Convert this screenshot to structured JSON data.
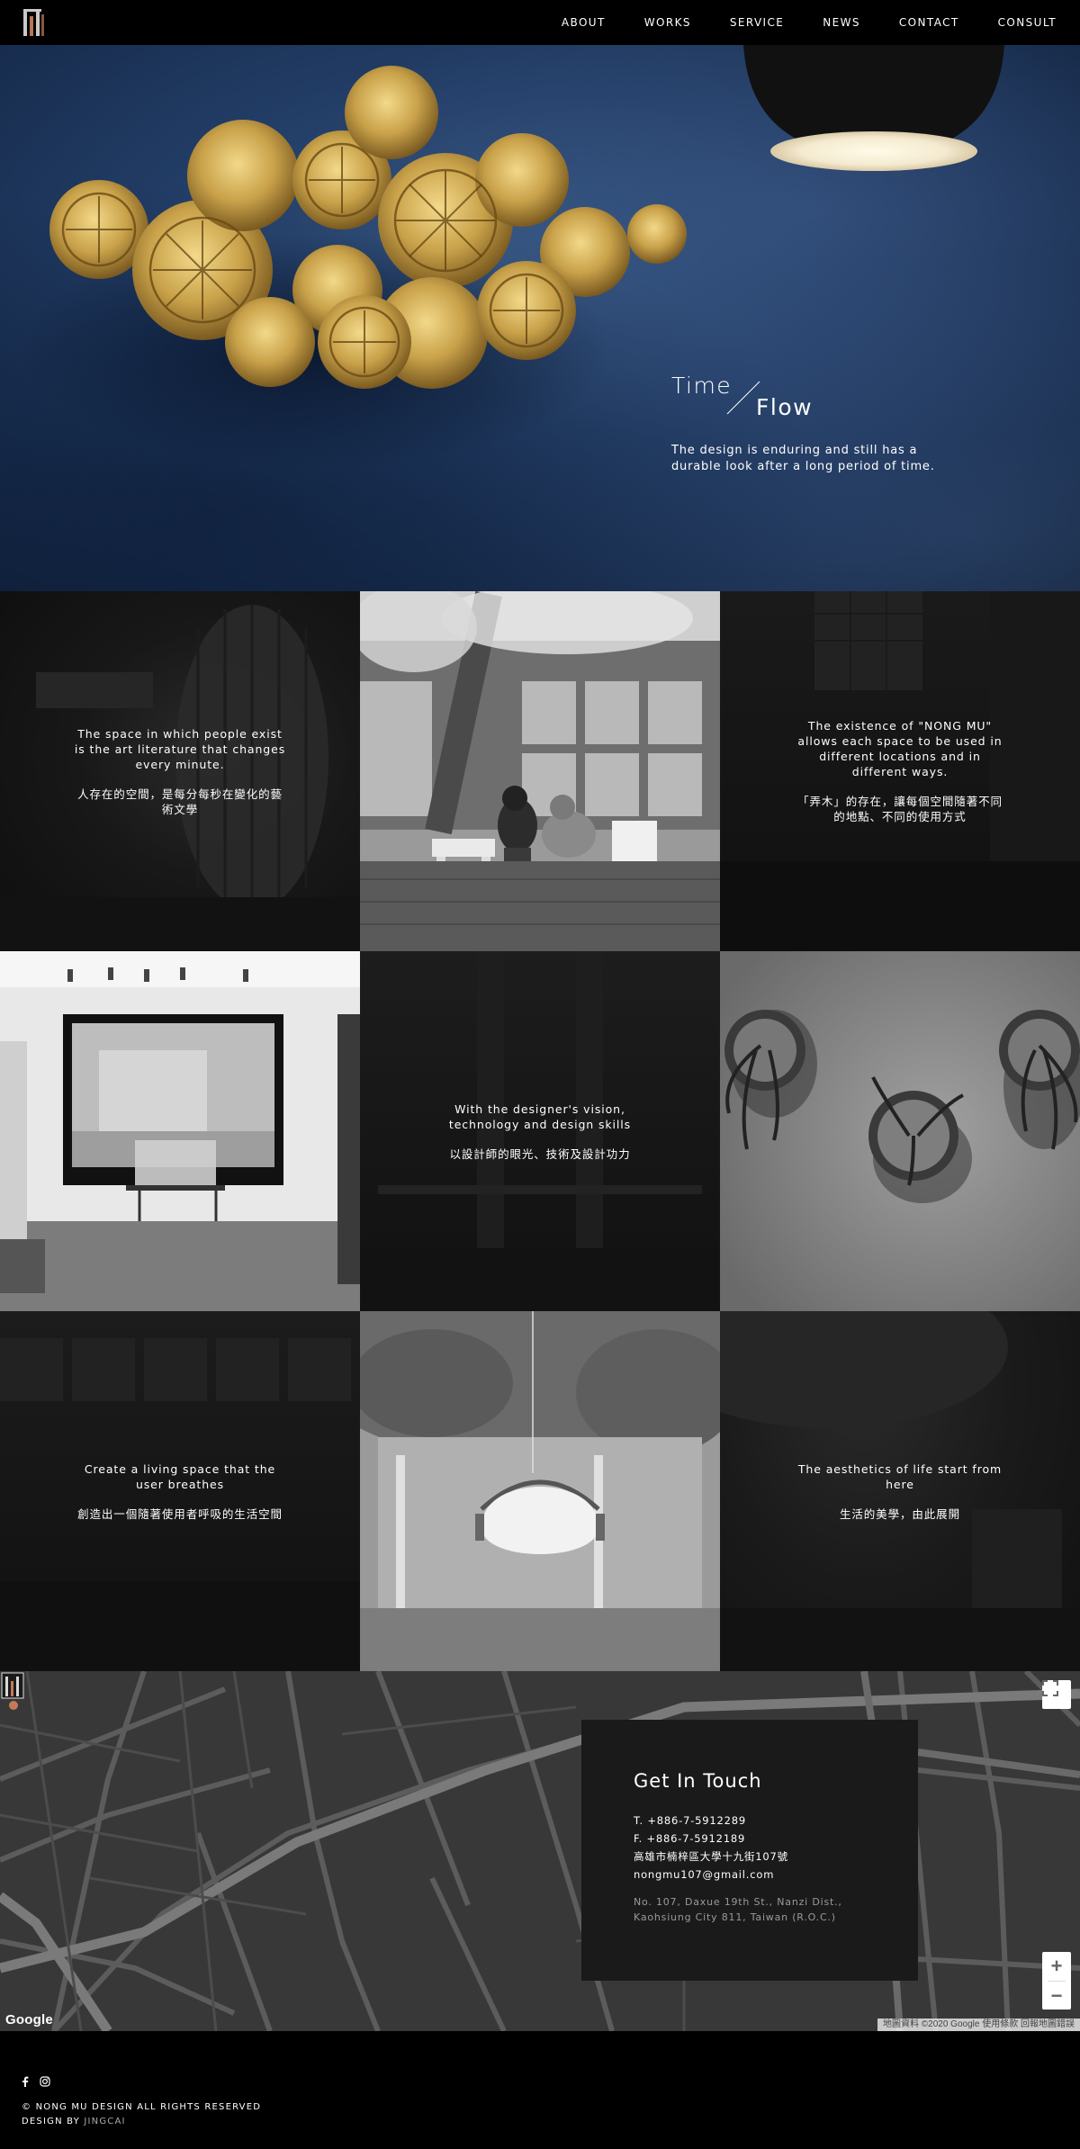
{
  "nav": {
    "items": [
      "ABOUT",
      "WORKS",
      "SERVICE",
      "NEWS",
      "CONTACT",
      "CONSULT"
    ]
  },
  "hero": {
    "word1": "Time",
    "word2": "Flow",
    "description": "The design is enduring and still has a durable look after a long period of time."
  },
  "grid": {
    "c1": {
      "en": "The space in which people exist is the art literature that changes every minute.",
      "zh": "人存在的空間，是每分每秒在變化的藝術文學"
    },
    "c3": {
      "en": "The existence of \"NONG MU\" allows each space to be used in different locations and in different ways.",
      "zh": "「弄木」的存在，讓每個空間隨著不同的地點、不同的使用方式"
    },
    "c5": {
      "en": "With the designer's vision, technology and design skills",
      "zh": "以設計師的眼光、技術及設計功力"
    },
    "c7": {
      "en": "Create a living space that the user breathes",
      "zh": "創造出一個隨著使用者呼吸的生活空間"
    },
    "c9": {
      "en": "The aesthetics of life start from here",
      "zh": "生活的美學，由此展開"
    }
  },
  "contact": {
    "title": "Get In Touch",
    "phone": "T. +886-7-5912289",
    "fax": "F. +886-7-5912189",
    "address_zh": "高雄市楠梓區大學十九街107號",
    "email": "nongmu107@gmail.com",
    "address_en_1": "No. 107, Daxue 19th St., Nanzi Dist.,",
    "address_en_2": "Kaohsiung City 811, Taiwan (R.O.C.)"
  },
  "map": {
    "google": "Google",
    "attribution": "地圖資料 ©2020 Google   使用條款   回報地圖錯誤",
    "zoom_in": "+",
    "zoom_out": "−"
  },
  "footer": {
    "copyright": "© NONG MU DESIGN ALL RIGHTS RESERVED",
    "design_by_label": "DESIGN BY",
    "design_by": "JINGCAI"
  },
  "icons": {
    "facebook": "facebook-icon",
    "instagram": "instagram-icon"
  },
  "colors": {
    "hero_blue": "#223d66",
    "gold": "#c9a24a",
    "card_bg": "#1a1a1a",
    "map_bg": "#3a3a3a"
  }
}
